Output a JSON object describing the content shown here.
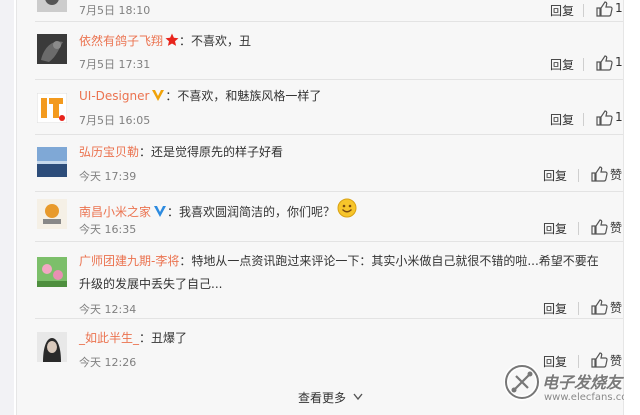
{
  "comments": [
    {
      "username": "",
      "text": "",
      "time": "7月5日 18:10",
      "reply_label": "回复",
      "like_count": "1"
    },
    {
      "username": "依然有鸽子飞翔",
      "badge": "red-star-icon",
      "text": "：不喜欢，丑",
      "time": "7月5日 17:31",
      "reply_label": "回复",
      "like_count": "1"
    },
    {
      "username": "UI-Designer",
      "badge": "gold-v-verified-icon",
      "text": "：不喜欢，和魅族风格一样了",
      "time": "7月5日 16:05",
      "reply_label": "回复",
      "like_count": "1"
    },
    {
      "username": "弘历宝贝勒",
      "text": "：还是觉得原先的样子好看",
      "time": "今天 17:39",
      "reply_label": "回复",
      "like_label": "赞"
    },
    {
      "username": "南昌小米之家",
      "badge": "blue-v-verified-icon",
      "text": "：我喜欢圆润简洁的，你们呢？",
      "emoji": "smile-emoji-icon",
      "time": "今天 16:35",
      "reply_label": "回复",
      "like_label": "赞"
    },
    {
      "username": "广师团建九期-李将",
      "text": "：特地从一点资讯跑过来评论一下：其实小米做自己就很不错的啦...希望不要在",
      "text_line2": "升级的发展中丢失了自己...",
      "time": "今天 12:34",
      "reply_label": "回复",
      "like_label": "赞"
    },
    {
      "username": "_如此半生_",
      "text": "：丑爆了",
      "time": "今天 12:26",
      "reply_label": "回复",
      "like_label": "赞"
    }
  ],
  "footer": {
    "more_label": "查看更多"
  },
  "colors": {
    "username": "#eb7350",
    "verified_name": "#2f6eb7",
    "panel_bg": "#f7f7f7"
  },
  "watermark": {
    "line1": "电子发烧友",
    "line2": "www.elecfans.com"
  }
}
